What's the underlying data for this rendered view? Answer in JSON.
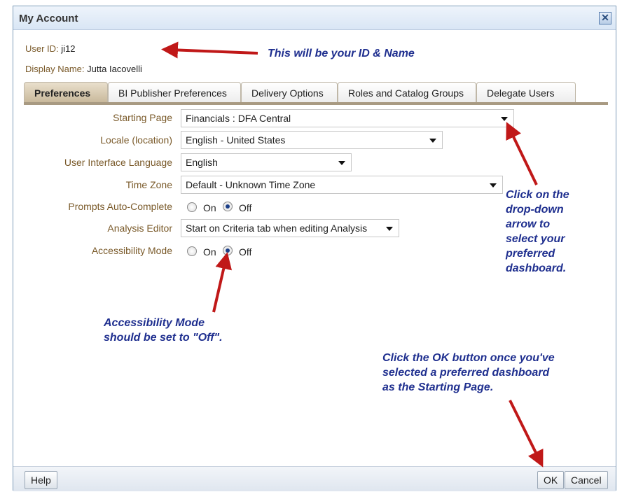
{
  "dialog": {
    "title": "My Account",
    "close_glyph": "✕"
  },
  "user": {
    "id_label": "User ID:",
    "id_value": "ji12",
    "display_label": "Display Name:",
    "display_value": "Jutta Iacovelli"
  },
  "tabs": [
    {
      "label": "Preferences",
      "active": true
    },
    {
      "label": "BI Publisher Preferences"
    },
    {
      "label": "Delivery Options"
    },
    {
      "label": "Roles and Catalog Groups"
    },
    {
      "label": "Delegate Users"
    }
  ],
  "preferences": {
    "starting_page": {
      "label": "Starting Page",
      "value": "Financials : DFA Central"
    },
    "locale": {
      "label": "Locale (location)",
      "value": "English - United States"
    },
    "ui_language": {
      "label": "User Interface Language",
      "value": "English"
    },
    "time_zone": {
      "label": "Time Zone",
      "value": "Default - Unknown Time Zone"
    },
    "prompts_autocomplete": {
      "label": "Prompts Auto-Complete",
      "on_label": "On",
      "off_label": "Off",
      "selected": "Off"
    },
    "analysis_editor": {
      "label": "Analysis Editor",
      "value": "Start on Criteria tab when editing Analysis"
    },
    "accessibility_mode": {
      "label": "Accessibility Mode",
      "on_label": "On",
      "off_label": "Off",
      "selected": "Off"
    }
  },
  "annotations": {
    "id_name": "This will be your ID & Name",
    "dropdown": [
      "Click on the",
      "drop-down",
      "arrow to",
      "select your",
      "preferred",
      "dashboard."
    ],
    "accessibility": [
      "Accessibility Mode",
      "should be set to \"Off\"."
    ],
    "ok_button": [
      "Click the OK button once you've",
      "selected a preferred dashboard",
      "as the Starting Page."
    ]
  },
  "footer": {
    "help_label": "Help",
    "ok_label": "OK",
    "cancel_label": "Cancel"
  },
  "colors": {
    "annotation_text": "#1f2f8f",
    "arrow": "#c01818",
    "label_text": "#7a5a2a",
    "active_tab": "#c8b89a"
  }
}
